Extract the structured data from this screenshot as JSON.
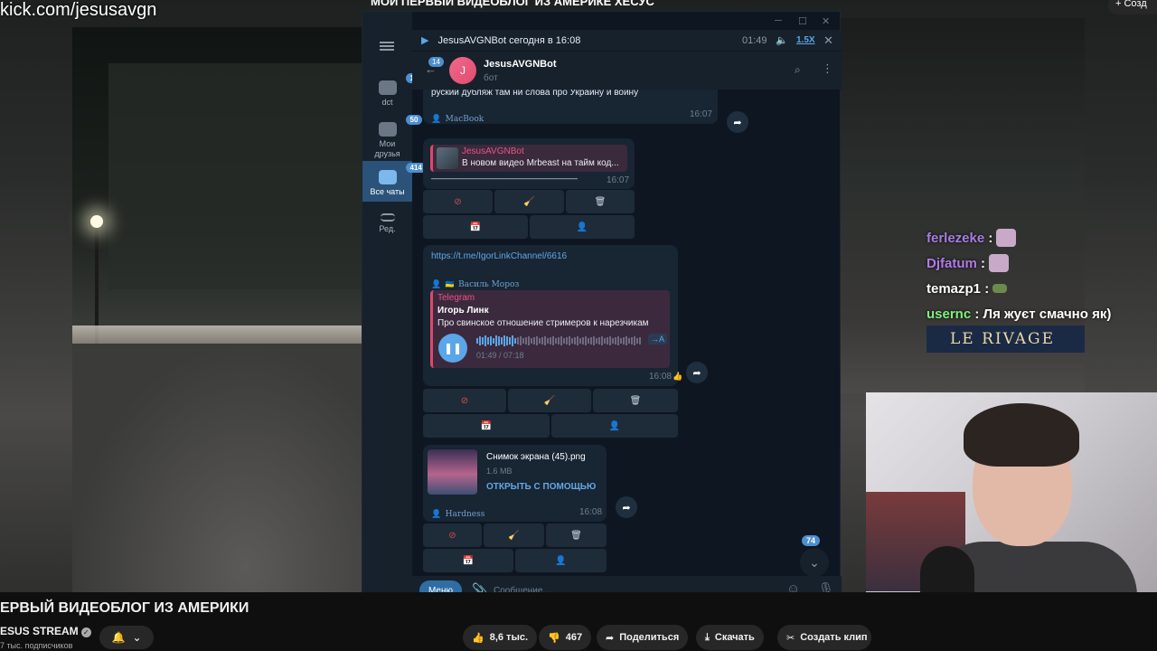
{
  "overlay": {
    "kick_url": "kick.com/jesusavgn",
    "top_title": "МОЙ ПЕРВЫЙ ВИДЕОБЛОГ ИЗ АМЕРИКЕ ХЕСУС",
    "top_create": "+ Созд",
    "store_sign": "LE RIVAGE"
  },
  "stream_chat": [
    {
      "user": "ferlezeke",
      "color": "#a77de0",
      "text": ":"
    },
    {
      "user": "Djfatum",
      "color": "#b07ae8",
      "text": ":"
    },
    {
      "user": "temazp1",
      "color": "#ffffff",
      "text": ":"
    },
    {
      "user": "usernc",
      "color": "#7ef07e",
      "text": ": Ля жуєт смачно як)"
    }
  ],
  "telegram": {
    "sidebar": [
      {
        "label": "dct",
        "badge": "190"
      },
      {
        "label": "Мои друзья",
        "badge": "50"
      },
      {
        "label": "Все чаты",
        "badge": "414"
      },
      {
        "label": "Ред.",
        "badge": ""
      }
    ],
    "player": {
      "title": "JesusAVGNBot сегодня в 16:08",
      "time": "01:49",
      "rate": "1.5X"
    },
    "header": {
      "back_badge": "14",
      "avatar_letter": "J",
      "name": "JesusAVGNBot",
      "status": "бот"
    },
    "messages": {
      "m1": {
        "text": "руский дубляж там ни слова про Украину и войну",
        "sig": "MacBook",
        "time": "16:07"
      },
      "m2": {
        "quote_author": "JesusAVGNBot",
        "quote_text": "В новом видео Mrbeast на тайм код...",
        "separator": "——————————————————",
        "time": "16:07"
      },
      "m3": {
        "link": "https://t.me/IgorLinkChannel/6616",
        "sig": "Василь Мороз",
        "quote_source": "Telegram",
        "quote_author": "Игорь Линк",
        "quote_text": "Про свинское отношение стримеров к нарезчикам",
        "audio_time": "01:49 / 07:18",
        "transcribe": "→A",
        "time": "16:08"
      },
      "m4": {
        "filename": "Снимок экрана (45).png",
        "size": "1.6 MB",
        "open": "ОТКРЫТЬ С ПОМОЩЬЮ",
        "sig": "Hardness",
        "time": "16:08"
      }
    },
    "unread_badge": "74",
    "composer": {
      "menu": "Меню",
      "placeholder": "Сообщение..."
    }
  },
  "youtube": {
    "title": "ЕРВЫЙ ВИДЕОБЛОГ ИЗ АМЕРИКИ",
    "channel": "ESUS STREAM",
    "subs": "7 тыс. подписчиков",
    "likes": "8,6 тыс.",
    "dislikes": "467",
    "share": "Поделиться",
    "download": "Скачать",
    "clip": "Создать клип"
  }
}
